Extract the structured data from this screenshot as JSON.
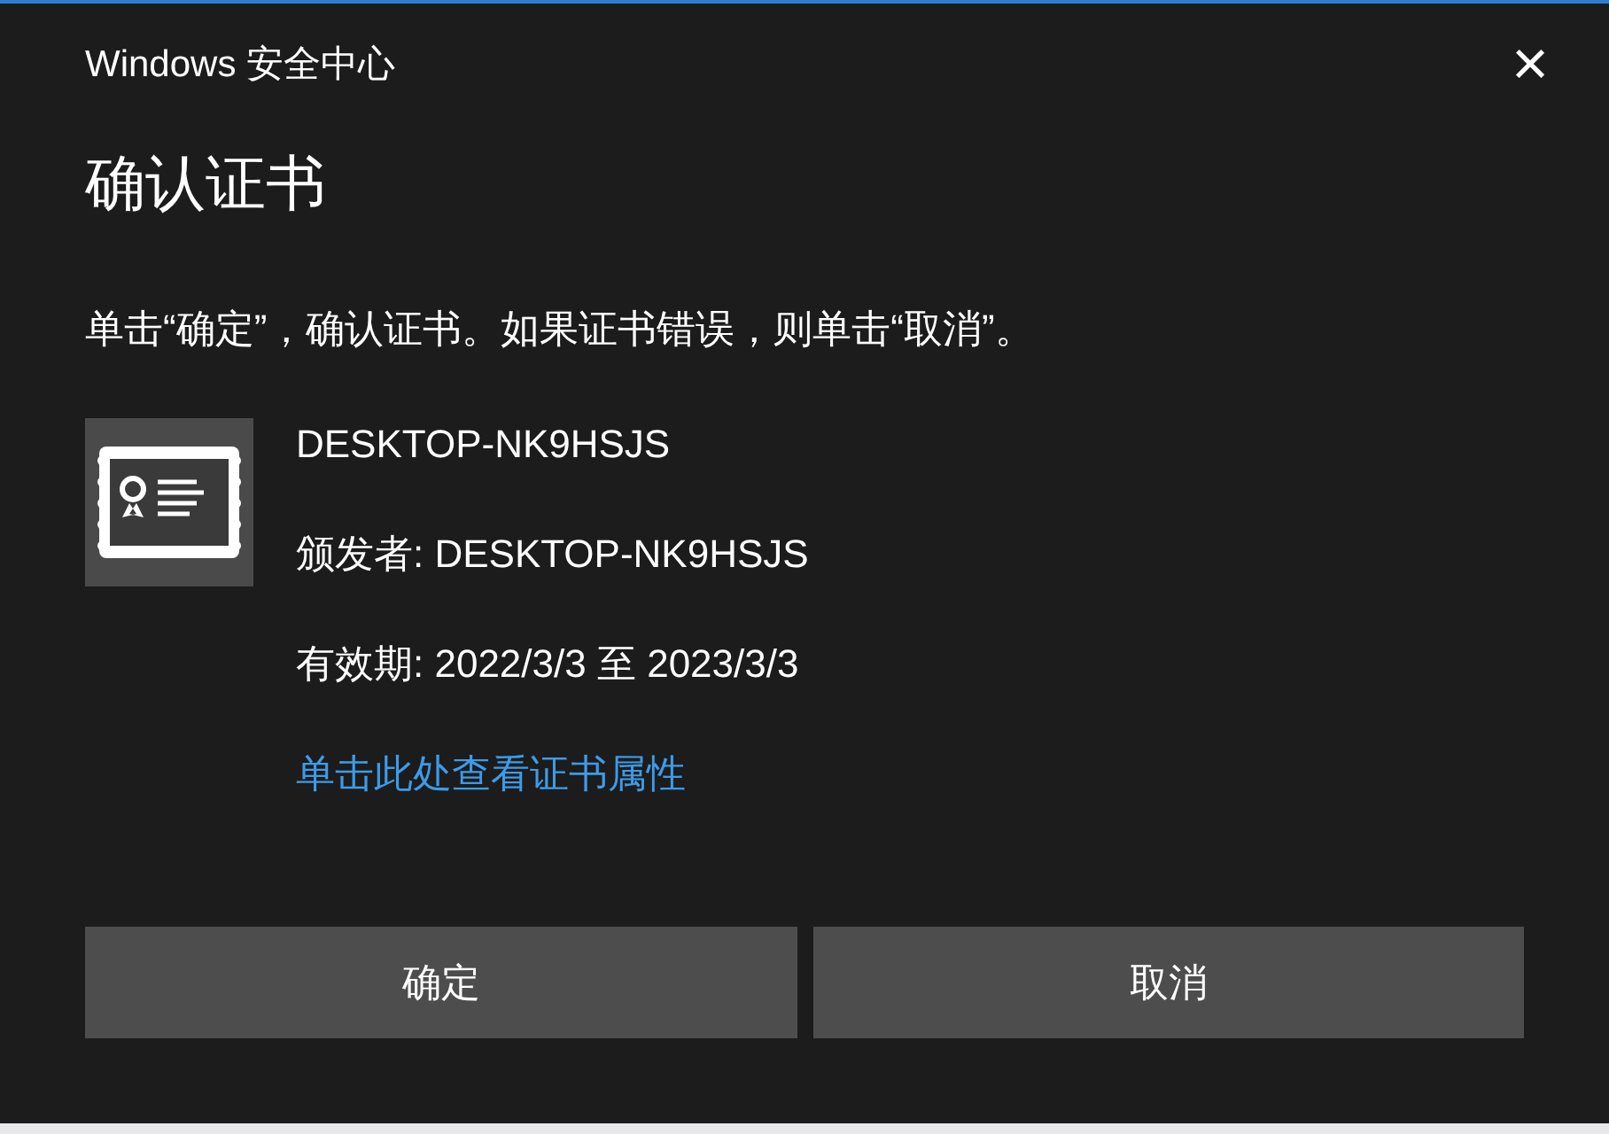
{
  "window": {
    "title": "Windows 安全中心",
    "close": "×"
  },
  "heading": "确认证书",
  "instruction": "单击“确定”，确认证书。如果证书错误，则单击“取消”。",
  "certificate": {
    "name": "DESKTOP-NK9HSJS",
    "issuer": "颁发者: DESKTOP-NK9HSJS",
    "validity": "有效期: 2022/3/3 至 2023/3/3",
    "link": "单击此处查看证书属性"
  },
  "buttons": [
    {
      "label": "确定"
    },
    {
      "label": "取消"
    }
  ]
}
